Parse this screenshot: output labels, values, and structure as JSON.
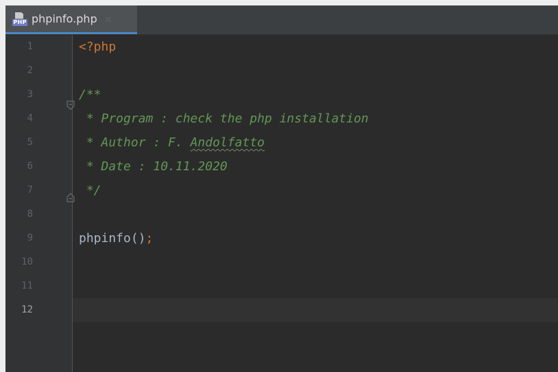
{
  "tab": {
    "icon": "php-file-icon",
    "icon_badge": "PHP",
    "title": "phpinfo.php",
    "close_glyph": "×",
    "underline_color": "#4a88c7"
  },
  "editor": {
    "current_line": 12,
    "line_numbers": [
      "1",
      "2",
      "3",
      "4",
      "5",
      "6",
      "7",
      "8",
      "9",
      "10",
      "11",
      "12"
    ],
    "lines": {
      "l1_tag": "<?php",
      "l3": "/**",
      "l4": " * Program : check the php installation",
      "l5_prefix": " * Author : F. ",
      "l5_name": "Andolfatto",
      "l6": " * Date : 10.11.2020",
      "l7": " */",
      "l9_fn": "phpinfo()",
      "l9_semi": ";"
    },
    "colors": {
      "keyword": "#cc7832",
      "comment": "#629755",
      "text": "#a9b7c6",
      "background": "#2b2b2b",
      "gutter": "#313335"
    }
  }
}
